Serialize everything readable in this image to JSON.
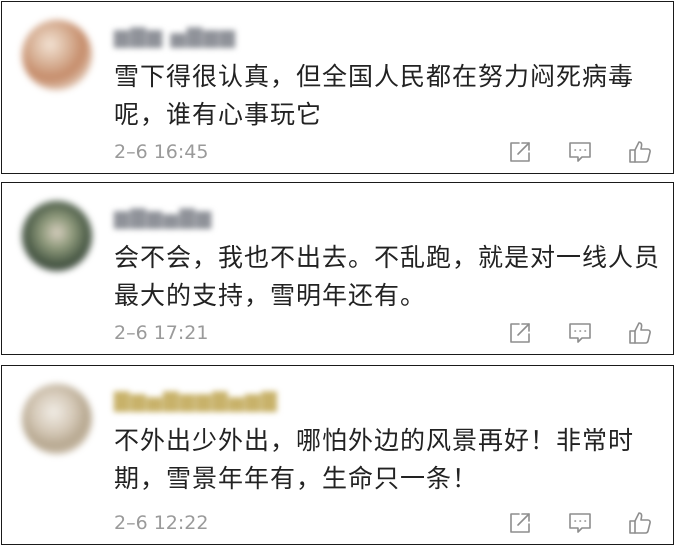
{
  "comments": [
    {
      "username": "▆▇▆ ▅▇▆▆",
      "username_style": "blurred-gray",
      "text_lines": [
        "雪下得很认真，但全国人民都在努力闷死病毒",
        "呢，谁有心事玩它"
      ],
      "timestamp": "2–6 16:45",
      "icons": {
        "share": "share-icon",
        "reply": "comment-icon",
        "like": "thumbs-up-icon"
      }
    },
    {
      "username": "▆▇▆▅▇▆",
      "username_style": "blurred-gray",
      "text_lines": [
        "会不会，我也不出去。不乱跑，就是对一线人员",
        "最大的支持，雪明年还有。"
      ],
      "timestamp": "2–6 17:21",
      "icons": {
        "share": "share-icon",
        "reply": "comment-icon",
        "like": "thumbs-up-icon"
      }
    },
    {
      "username": "▇▆▅▇▆▆▇▅▆▇",
      "username_style": "blurred-gold",
      "text_lines": [
        "不外出少外出，哪怕外边的风景再好！非常时",
        "期，雪景年年有，生命只一条！"
      ],
      "timestamp": "2–6 12:22",
      "icons": {
        "share": "share-icon",
        "reply": "comment-icon",
        "like": "thumbs-up-icon"
      }
    }
  ],
  "colors": {
    "card_border": "#1a1a1a",
    "text": "#222222",
    "timestamp": "#9a9a9a",
    "icon": "#8e8e8e"
  }
}
